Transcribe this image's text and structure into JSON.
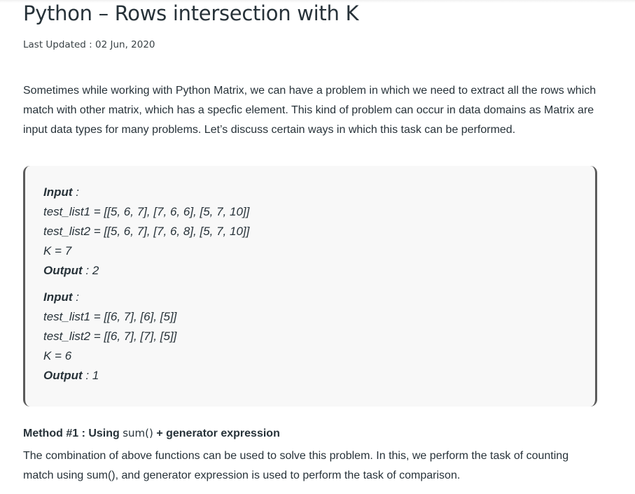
{
  "article": {
    "title": "Python – Rows intersection with K",
    "updated": "Last Updated : 02 Jun, 2020",
    "intro": "Sometimes while working with Python Matrix, we can have a problem in which we need to extract all the rows which match with other matrix, which has a specfic element. This kind of problem can occur in data domains as Matrix are input data types for many problems. Let’s discuss certain ways in which this task can be performed."
  },
  "examples": [
    {
      "input_label": "Input",
      "input_colon": " :",
      "list1": "test_list1 = [[5, 6, 7], [7, 6, 6], [5, 7, 10]]",
      "list2": "test_list2 = [[5, 6, 7], [7, 6, 8], [5, 7, 10]]",
      "k": "K = 7",
      "output_label": "Output",
      "output_value": " : 2"
    },
    {
      "input_label": "Input",
      "input_colon": " :",
      "list1": "test_list1 = [[6, 7], [6], [5]]",
      "list2": "test_list2 = [[6, 7], [7], [5]]",
      "k": "K = 6",
      "output_label": "Output",
      "output_value": " : 1"
    }
  ],
  "method": {
    "heading_prefix": "Method #1 : Using ",
    "heading_code": "sum()",
    "heading_suffix": " + generator expression",
    "text": "The combination of above functions can be used to solve this problem. In this, we perform the task of counting match using sum(), and generator expression is used to perform the task of comparison."
  },
  "colors": {
    "text": "#273239",
    "box_background": "#f8f8f8",
    "box_border": "#5b5b5b"
  }
}
